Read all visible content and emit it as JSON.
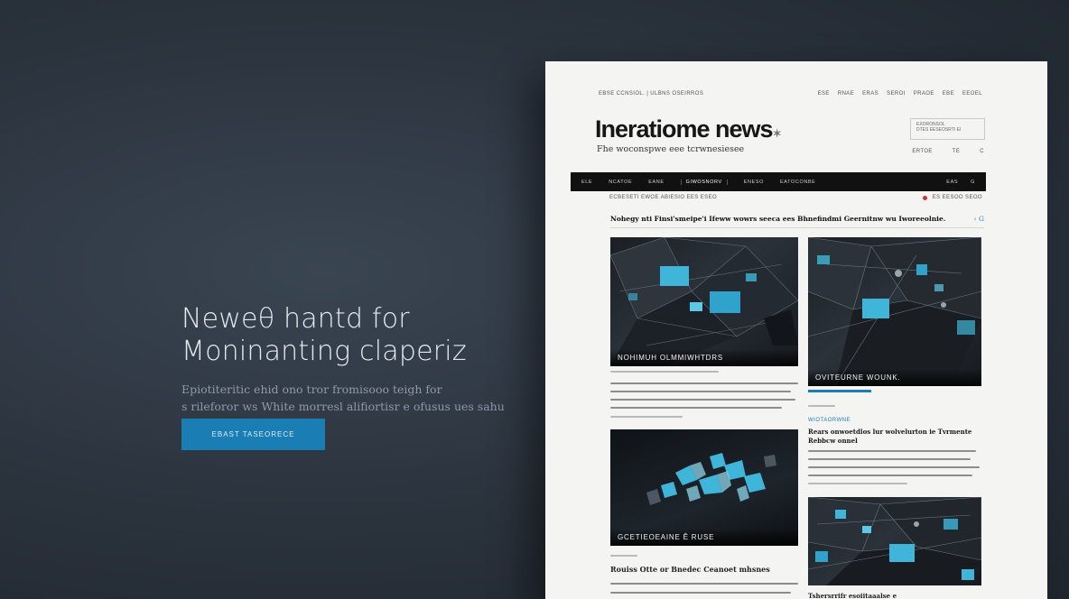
{
  "hero": {
    "title_line1": "Newеθ hantd for",
    "title_line2": "Moninanting claperiz",
    "subtitle_line1": "Epiotiteritic ehid ono tror fromisooo teigh for",
    "subtitle_line2": "s rileforor ws White morresl alifiortisr e ofusus ues sahu",
    "cta_label": "Ebast Taseorece"
  },
  "paper": {
    "top_left_text": "Ebse ccnsiol. | Ulbns oseirros",
    "top_nav": [
      "Ese",
      "Rnae",
      "Eras",
      "Seroi",
      "Praoe",
      "Ebe",
      "Eeoel"
    ],
    "masthead": "Ineratiome news",
    "masthead_mark": "✶",
    "tagline": "Fhe woconspwe eee tcrwnesiesee",
    "subscribe_label_1": "Exoronsol",
    "subscribe_label_2": "Dtes eeseosrti ei",
    "sub_links": [
      "Ertoe",
      "Te",
      "C"
    ],
    "nav_items": [
      "Ele",
      "Ncatoe",
      "Eane",
      "Giwosnorv",
      "Eneso",
      "Eatoconbe"
    ],
    "nav_right": [
      "Eas",
      "G"
    ],
    "sub_row_left": "Ecbeseti ewoe abiesio  Ees Eseo",
    "sub_row_right": "Es  Eesoo seoo",
    "headline": "Nohegy nti Finsi'smeipe'i Ifeww wowrs seeca ees Bhnefindmi Geernitnw wu Iworeeolnie.",
    "headline_share": "‹ G",
    "card1_caption": "Nohimuh olmmiwhtdrs",
    "card2_caption": "Oviteurne wounk.",
    "card3_caption": "Gcetieoeaine ê ruse",
    "side_tag": "Wiotaorwne",
    "side_headline": "Rears onwoetdlos lur wolvelurton ie Tvrmente Rebbcw onnel",
    "card3_title": "Rouiss Otte  or  Bnedec Ceanoet mhsnes",
    "bottom_right_title": "Tshersrrifr esoiitaaalse e"
  },
  "colors": {
    "accent": "#1a7eb5",
    "highlight": "#3fb6d9",
    "background": "#2a323c"
  }
}
